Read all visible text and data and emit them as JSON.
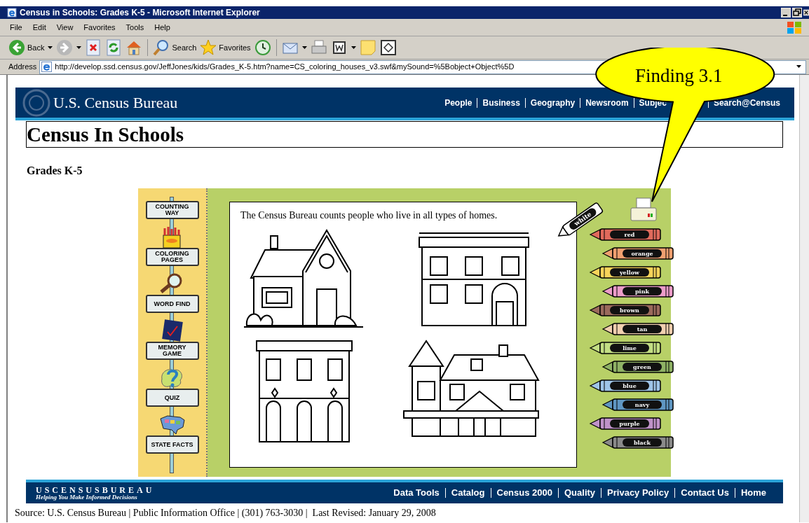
{
  "window": {
    "title": "Census in Schools: Grades K-5 - Microsoft Internet Explorer"
  },
  "menu": [
    "File",
    "Edit",
    "View",
    "Favorites",
    "Tools",
    "Help"
  ],
  "toolbar": [
    {
      "kind": "back",
      "label": "Back"
    },
    {
      "kind": "forward"
    },
    {
      "kind": "stop"
    },
    {
      "kind": "refresh"
    },
    {
      "kind": "home"
    },
    {
      "kind": "search",
      "label": "Search"
    },
    {
      "kind": "favorites",
      "label": "Favorites"
    },
    {
      "kind": "history"
    },
    {
      "kind": "mail"
    },
    {
      "kind": "print"
    },
    {
      "kind": "word"
    },
    {
      "kind": "note"
    },
    {
      "kind": "window"
    }
  ],
  "address": {
    "label": "Address",
    "url": "http://develop.ssd.census.gov/JeffJones/kids/Grades_K-5.htm?name=CS_coloring_houses_v3.swf&mySound=%5Bobject+Object%5D"
  },
  "site_header": {
    "logo": "U.S. Census Bureau",
    "nav": [
      "People",
      "Business",
      "Geography",
      "Newsroom",
      "Subjec",
      "Search@Census"
    ]
  },
  "page_title": "Census In Schools",
  "subtitle": "Grades K-5",
  "activity": {
    "signs": [
      {
        "label": "COUNTING WAY",
        "kind": "plain"
      },
      {
        "label": "COLORING PAGES",
        "kind": "crayons"
      },
      {
        "label": "WORD FIND",
        "kind": "magnifier"
      },
      {
        "label": "MEMORY GAME",
        "kind": "card"
      },
      {
        "label": "QUIZ",
        "kind": "question"
      },
      {
        "label": "STATE FACTS",
        "kind": "map"
      }
    ],
    "caption": "The Census Bureau counts people who live in all types of homes.",
    "white_crayon": "white",
    "crayons": [
      {
        "label": "red",
        "color": "#e06a5c"
      },
      {
        "label": "orange",
        "color": "#f0a070"
      },
      {
        "label": "yellow",
        "color": "#f7d35a"
      },
      {
        "label": "pink",
        "color": "#ec9cc9"
      },
      {
        "label": "brown",
        "color": "#9a6a5c"
      },
      {
        "label": "tan",
        "color": "#f1cfb0"
      },
      {
        "label": "lime",
        "color": "#c3de84"
      },
      {
        "label": "green",
        "color": "#8fb265"
      },
      {
        "label": "blue",
        "color": "#9fc5e8"
      },
      {
        "label": "navy",
        "color": "#5f96c2"
      },
      {
        "label": "purple",
        "color": "#bf92c8"
      },
      {
        "label": "black",
        "color": "#8a8a8a"
      }
    ]
  },
  "footer": {
    "logo": "USCENSUSBUREAU",
    "tagline": "Helping You Make Informed Decisions",
    "links": [
      "Data Tools",
      "Catalog",
      "Census 2000",
      "Quality",
      "Privacy Policy",
      "Contact Us",
      "Home"
    ]
  },
  "source_line": "Source: U.S. Census Bureau | Public Information Office | (301) 763-3030 |  Last Revised: January 29, 2008",
  "callout": "Finding 3.1"
}
